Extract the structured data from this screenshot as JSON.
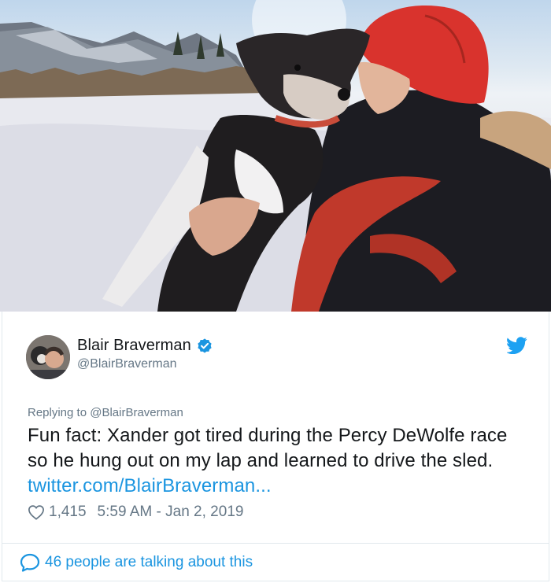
{
  "tweet": {
    "display_name": "Blair Braverman",
    "handle": "@BlairBraverman",
    "replying_to": "Replying to @BlairBraverman",
    "text": "Fun fact: Xander got tired during the Percy DeWolfe race so he hung out on my lap and learned to drive the sled. ",
    "link": "twitter.com/BlairBraverman...",
    "likes": "1,415",
    "timestamp": "5:59 AM - Jan 2, 2019",
    "talking": "46 people are talking about this"
  },
  "icons": {
    "verified": "verified-badge-icon",
    "bird": "twitter-bird-icon",
    "heart": "heart-icon",
    "bubble": "speech-bubble-icon"
  },
  "colors": {
    "accent": "#1b95e0",
    "secondary_text": "#657786",
    "primary_text": "#14171a"
  }
}
